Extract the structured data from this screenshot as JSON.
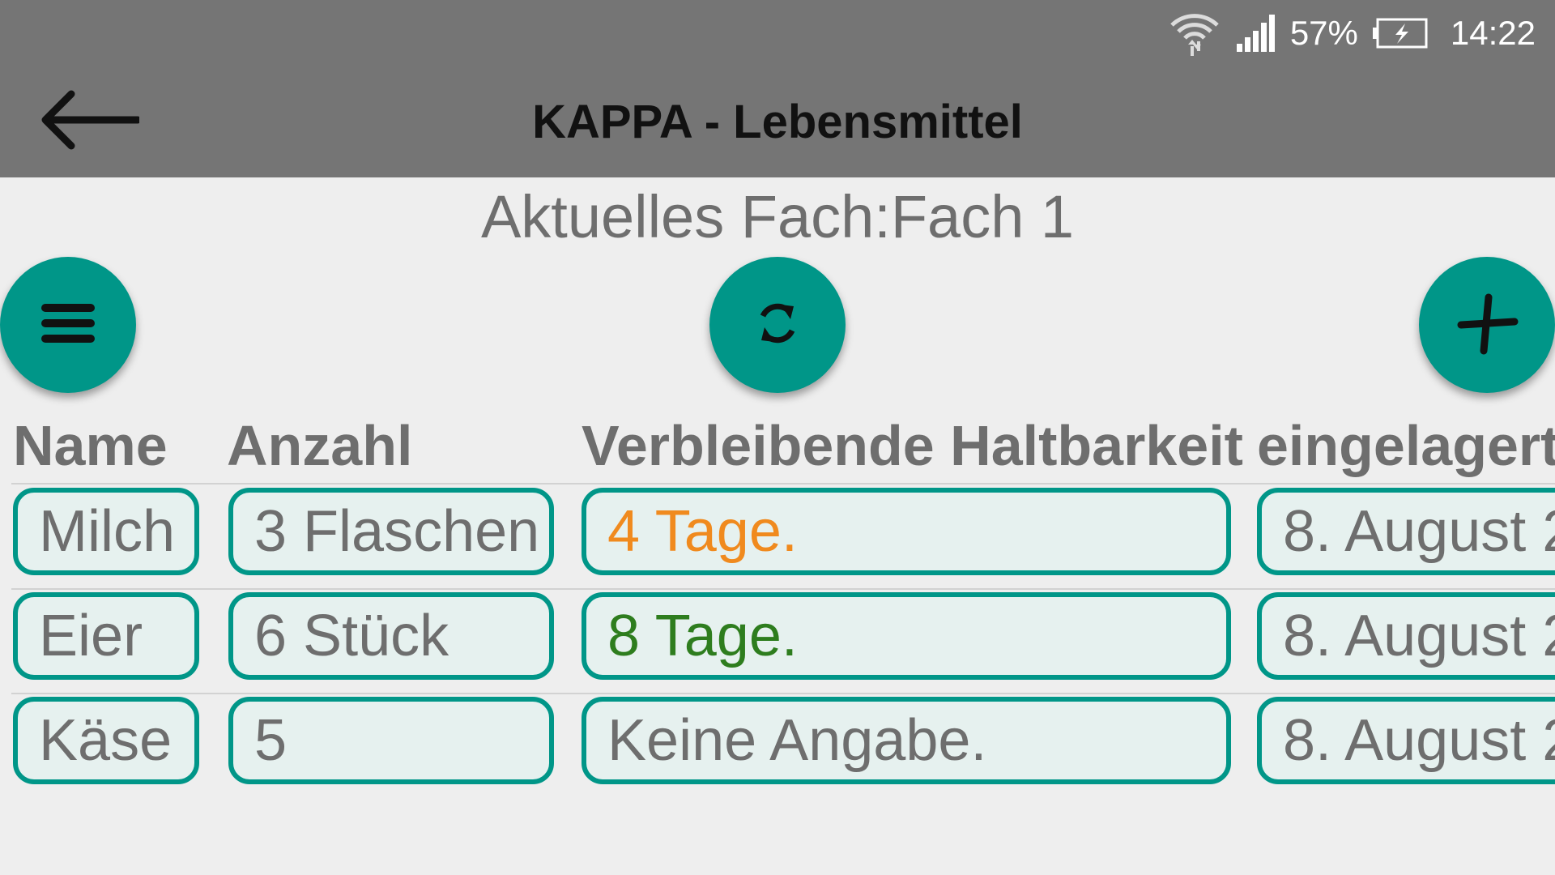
{
  "status_bar": {
    "battery_percent": "57%",
    "time": "14:22",
    "icons": [
      "wifi-icon",
      "signal-icon",
      "battery-icon"
    ]
  },
  "toolbar": {
    "title": "KAPPA - Lebensmittel",
    "back_icon": "arrow-left-icon"
  },
  "current_fach": "Aktuelles Fach:Fach 1",
  "fabs": {
    "menu_icon": "hamburger-menu-icon",
    "refresh_icon": "sync-icon",
    "add_icon": "plus-icon"
  },
  "table": {
    "headers": [
      "Name",
      "Anzahl",
      "Verbleibende Haltbarkeit",
      "eingelagert"
    ],
    "rows": [
      {
        "name": "Milch",
        "anzahl": "3 Flaschen",
        "haltbarkeit": "4 Tage.",
        "eingelagert": "8. August 2"
      },
      {
        "name": "Eier",
        "anzahl": "6 Stück",
        "haltbarkeit": "8 Tage.",
        "eingelagert": "8. August 2"
      },
      {
        "name": "Käse",
        "anzahl": "5",
        "haltbarkeit": "Keine Angabe.",
        "eingelagert": "8. August 2"
      }
    ]
  },
  "colors": {
    "accent": "#009688",
    "toolbar": "#757575",
    "background": "#eeeeee",
    "warning_text": "#f08a1e",
    "ok_text": "#2e7d1e"
  }
}
